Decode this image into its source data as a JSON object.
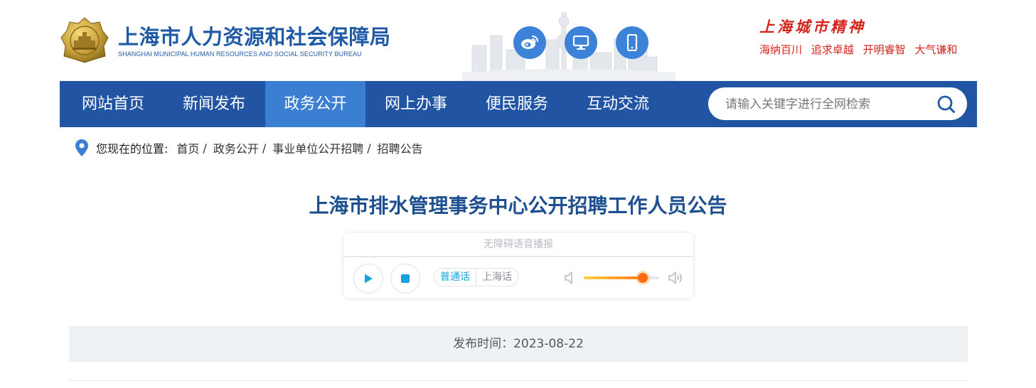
{
  "header": {
    "title_cn": "上海市人力资源和社会保障局",
    "title_en": "SHANGHAI MUNICIPAL HUMAN RESOURCES AND SOCIAL SECURITY BUREAU",
    "icons": [
      "weibo-icon",
      "desktop-icon",
      "mobile-icon"
    ],
    "spirit": {
      "title": "上海城市精神",
      "words": [
        "海纳百川",
        "追求卓越",
        "开明睿智",
        "大气谦和"
      ]
    }
  },
  "nav": {
    "items": [
      {
        "label": "网站首页"
      },
      {
        "label": "新闻发布"
      },
      {
        "label": "政务公开"
      },
      {
        "label": "网上办事"
      },
      {
        "label": "便民服务"
      },
      {
        "label": "互动交流"
      }
    ],
    "active": "政务公开",
    "search_placeholder": "请输入关键字进行全网检索"
  },
  "breadcrumb": {
    "here": "您现在的位置:",
    "items": [
      "首页",
      "政务公开",
      "事业单位公开招聘",
      "招聘公告"
    ],
    "separator": "/"
  },
  "article": {
    "title": "上海市排水管理事务中心公开招聘工作人员公告",
    "player": {
      "header": "无障碍语音播报",
      "lang_options": [
        "普通话",
        "上海话"
      ],
      "selected_lang": "普通话",
      "volume": 0.78
    },
    "publish": "发布时间：2023-08-22"
  },
  "colors": {
    "nav_bg": "#2155a4",
    "nav_active": "#3b7fd3",
    "brand_blue": "#1f5aa6",
    "title_blue": "#1d4f91",
    "spirit_red": "#d4241c",
    "icon_circle": "#3c82d8"
  }
}
